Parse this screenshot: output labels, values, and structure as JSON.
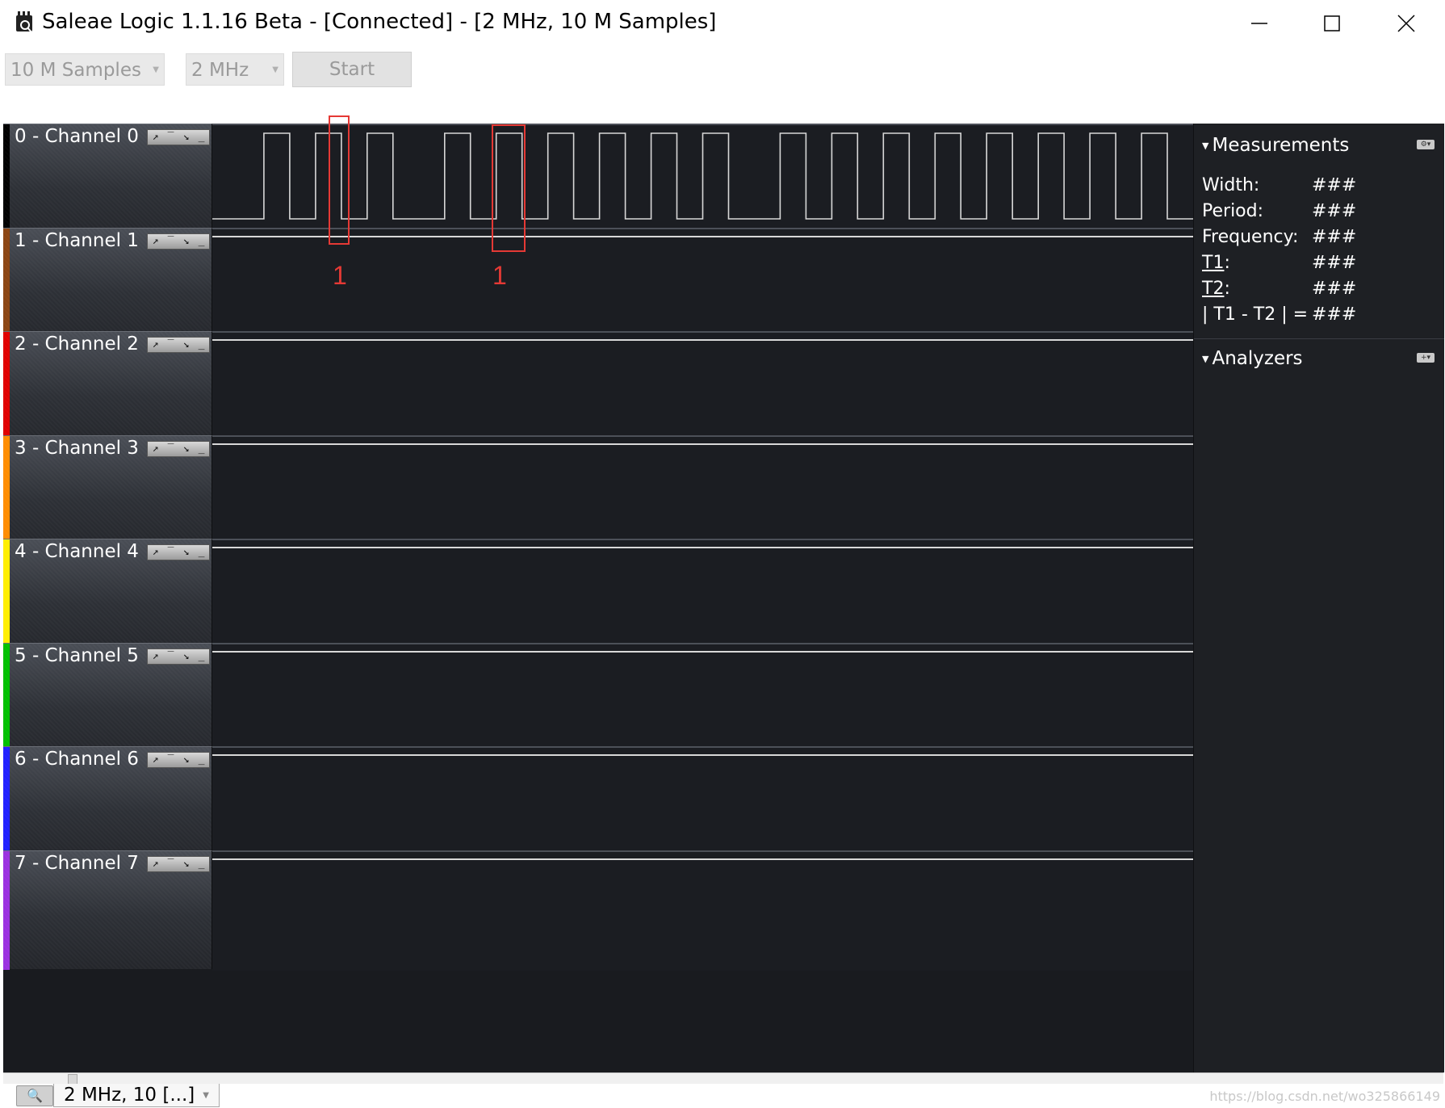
{
  "window": {
    "title": "Saleae Logic 1.1.16 Beta - [Connected] - [2 MHz, 10 M Samples]",
    "controls": [
      "minimize-icon",
      "maximize-icon",
      "close-icon"
    ]
  },
  "toolbar": {
    "samples_value": "10 M Samples",
    "rate_value": "2 MHz",
    "start_label": "Start"
  },
  "channels": [
    {
      "label": "0 - Channel 0",
      "color": "#000000",
      "active": true
    },
    {
      "label": "1 - Channel 1",
      "color": "#8b4513",
      "active": false
    },
    {
      "label": "2 - Channel 2",
      "color": "#e00000",
      "active": false
    },
    {
      "label": "3 - Channel 3",
      "color": "#ff8c00",
      "active": false
    },
    {
      "label": "4 - Channel 4",
      "color": "#ffee00",
      "active": false
    },
    {
      "label": "5 - Channel 5",
      "color": "#00c000",
      "active": false
    },
    {
      "label": "6 - Channel 6",
      "color": "#2020ff",
      "active": false
    },
    {
      "label": "7 - Channel 7",
      "color": "#9a30e0",
      "active": false
    }
  ],
  "trigger_icons": [
    "rising-edge-icon",
    "high-level-icon",
    "falling-edge-icon",
    "low-level-icon"
  ],
  "channel0_waveform": [
    0,
    0,
    1,
    0,
    1,
    0,
    1,
    0,
    0,
    1,
    0,
    1,
    0,
    1,
    0,
    1,
    0,
    1,
    0,
    1,
    0,
    0,
    1,
    0,
    1,
    0,
    1,
    0,
    1,
    0,
    1,
    0,
    1,
    0,
    1,
    0,
    1,
    0
  ],
  "annotations": [
    "1",
    "1"
  ],
  "measurements": {
    "header": "Measurements",
    "rows": [
      {
        "label": "Width:",
        "value": "###"
      },
      {
        "label": "Period:",
        "value": "###"
      },
      {
        "label": "Frequency:",
        "value": "###"
      },
      {
        "label": "T1",
        "suffix": ":",
        "value": "###"
      },
      {
        "label": "T2",
        "suffix": ":",
        "value": "###"
      },
      {
        "label": "| T1 - T2 | =",
        "value": "###"
      }
    ]
  },
  "analyzers": {
    "header": "Analyzers"
  },
  "bottom": {
    "capture_tab": "2 MHz, 10 [...]",
    "watermark": "https://blog.csdn.net/wo325866149"
  },
  "colors": {
    "background": "#191b1f",
    "trace": "#d8d8d8",
    "annotation": "#e53935"
  }
}
